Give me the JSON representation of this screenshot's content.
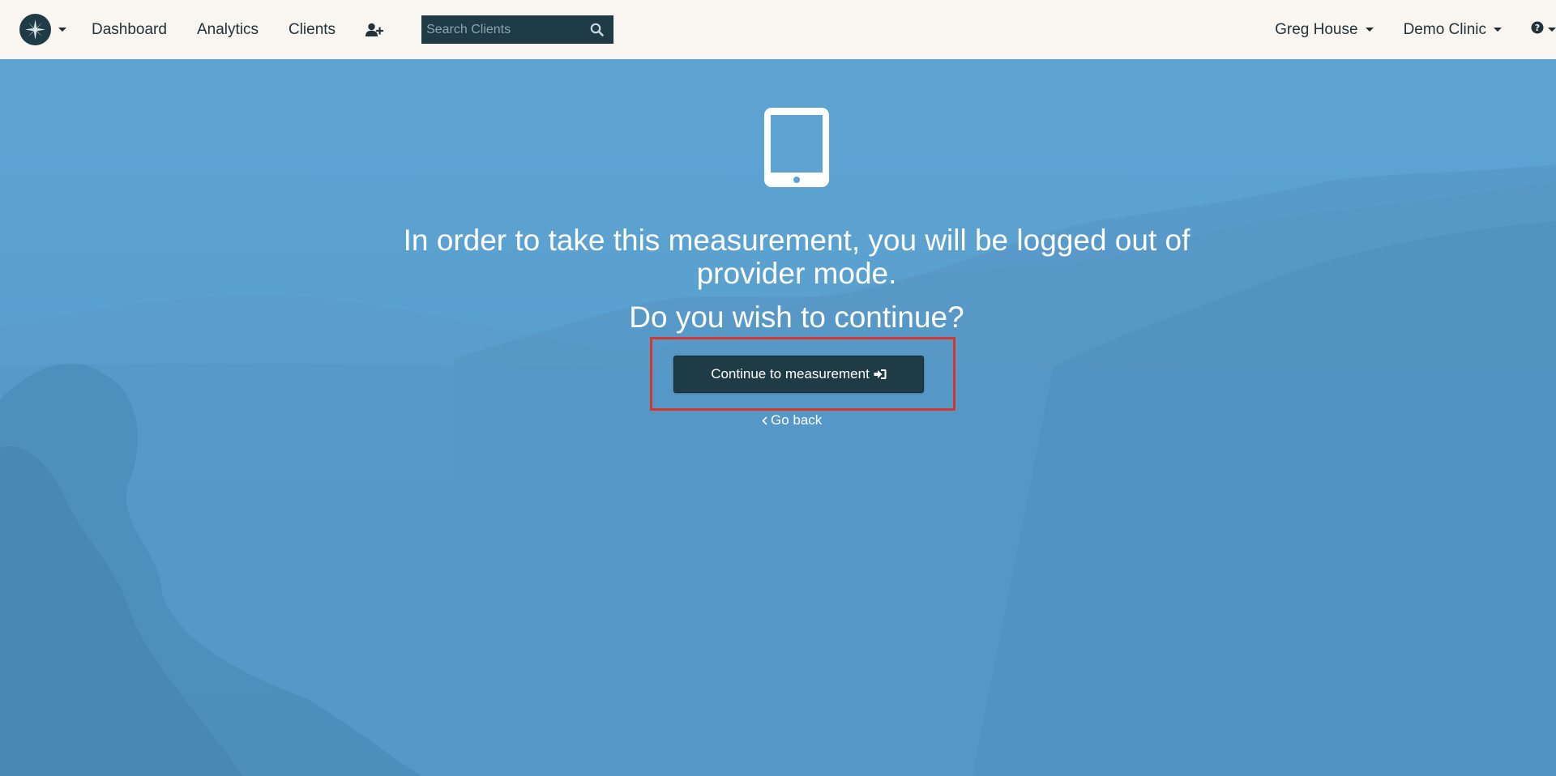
{
  "navbar": {
    "logo_icon": "starburst-logo-icon",
    "links": {
      "dashboard": "Dashboard",
      "analytics": "Analytics",
      "clients": "Clients"
    },
    "add_client_icon": "user-plus-icon",
    "search": {
      "placeholder": "Search Clients",
      "value": "",
      "icon": "search-icon"
    },
    "user_menu": "Greg House",
    "clinic_menu": "Demo Clinic",
    "help_icon": "question-circle-icon"
  },
  "dialog": {
    "icon": "tablet-icon",
    "message": "In order to take this measurement, you will be logged out of provider mode.",
    "question": "Do you wish to continue?",
    "continue_label": "Continue to measurement",
    "continue_icon": "sign-in-icon",
    "go_back_label": "Go back"
  },
  "colors": {
    "navbar_bg": "#f9f6f1",
    "primary_dark": "#1f3b45",
    "hero_blue": "#5a9dcb",
    "highlight": "#d6372b"
  }
}
